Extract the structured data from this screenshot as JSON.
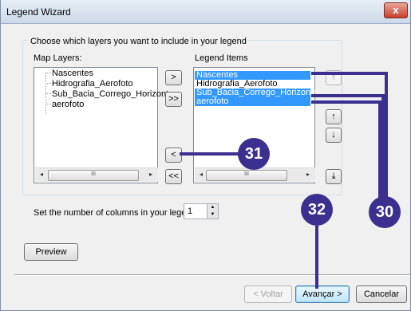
{
  "window": {
    "title": "Legend Wizard",
    "close_glyph": "x"
  },
  "instruction": "Choose which layers you want to include in your legend",
  "map_layers": {
    "label": "Map Layers:",
    "items": [
      "Nascentes",
      "Hidrografia_Aerofoto",
      "Sub_Bacia_Corrego_Horizonte",
      "aerofoto"
    ]
  },
  "legend_items": {
    "label": "Legend Items",
    "items": [
      {
        "text": "Nascentes",
        "selected": true
      },
      {
        "text": "Hidrografia_Aerofoto",
        "selected": false
      },
      {
        "text": "Sub_Bacia_Corrego_Horizonte",
        "selected": true
      },
      {
        "text": "aerofoto",
        "selected": true
      }
    ]
  },
  "transfer_buttons": {
    "add": ">",
    "add_all": ">>",
    "remove": "<",
    "remove_all": "<<"
  },
  "order_buttons": {
    "top": "⤒",
    "up": "↑",
    "down": "↓",
    "bottom": "⤓"
  },
  "scrollbar": {
    "left_arrow": "◂",
    "right_arrow": "▸",
    "thumb_grip": "III"
  },
  "columns": {
    "label": "Set the number of columns in your legend:",
    "value": "1"
  },
  "preview_label": "Preview",
  "footer": {
    "back_label": "< Voltar",
    "next_label": "Avançar >",
    "cancel_label": "Cancelar"
  },
  "annotations": {
    "a": "31",
    "b": "32",
    "c": "30",
    "color": "#3b2f8f"
  }
}
